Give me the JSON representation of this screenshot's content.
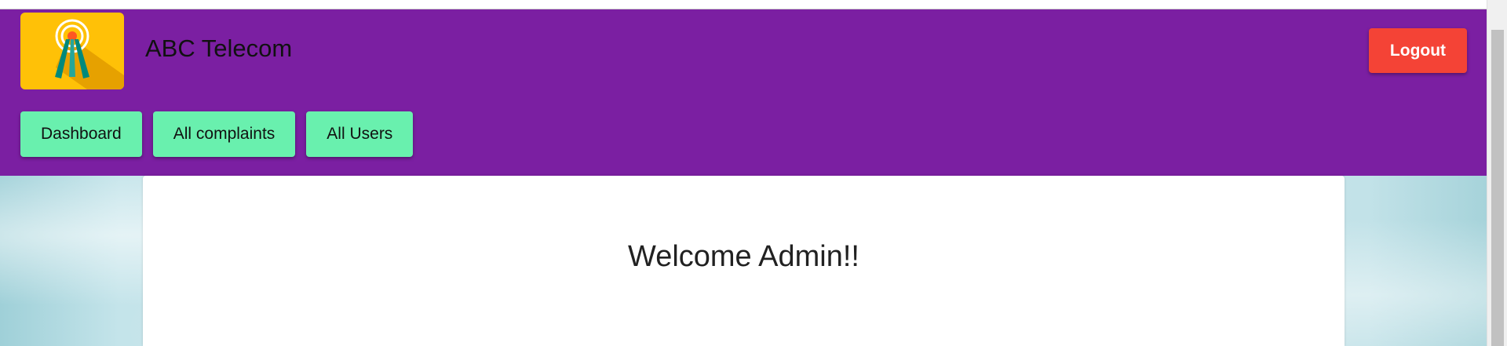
{
  "header": {
    "brand": "ABC Telecom",
    "logout_label": "Logout"
  },
  "nav": {
    "items": [
      {
        "label": "Dashboard"
      },
      {
        "label": "All complaints"
      },
      {
        "label": "All Users"
      }
    ]
  },
  "main": {
    "welcome": "Welcome Admin!!"
  },
  "colors": {
    "header_bg": "#7b1fa2",
    "nav_button": "#69f0ae",
    "logout_button": "#f44336",
    "logo_bg": "#ffc107"
  },
  "icons": {
    "logo": "antenna-tower-icon"
  }
}
